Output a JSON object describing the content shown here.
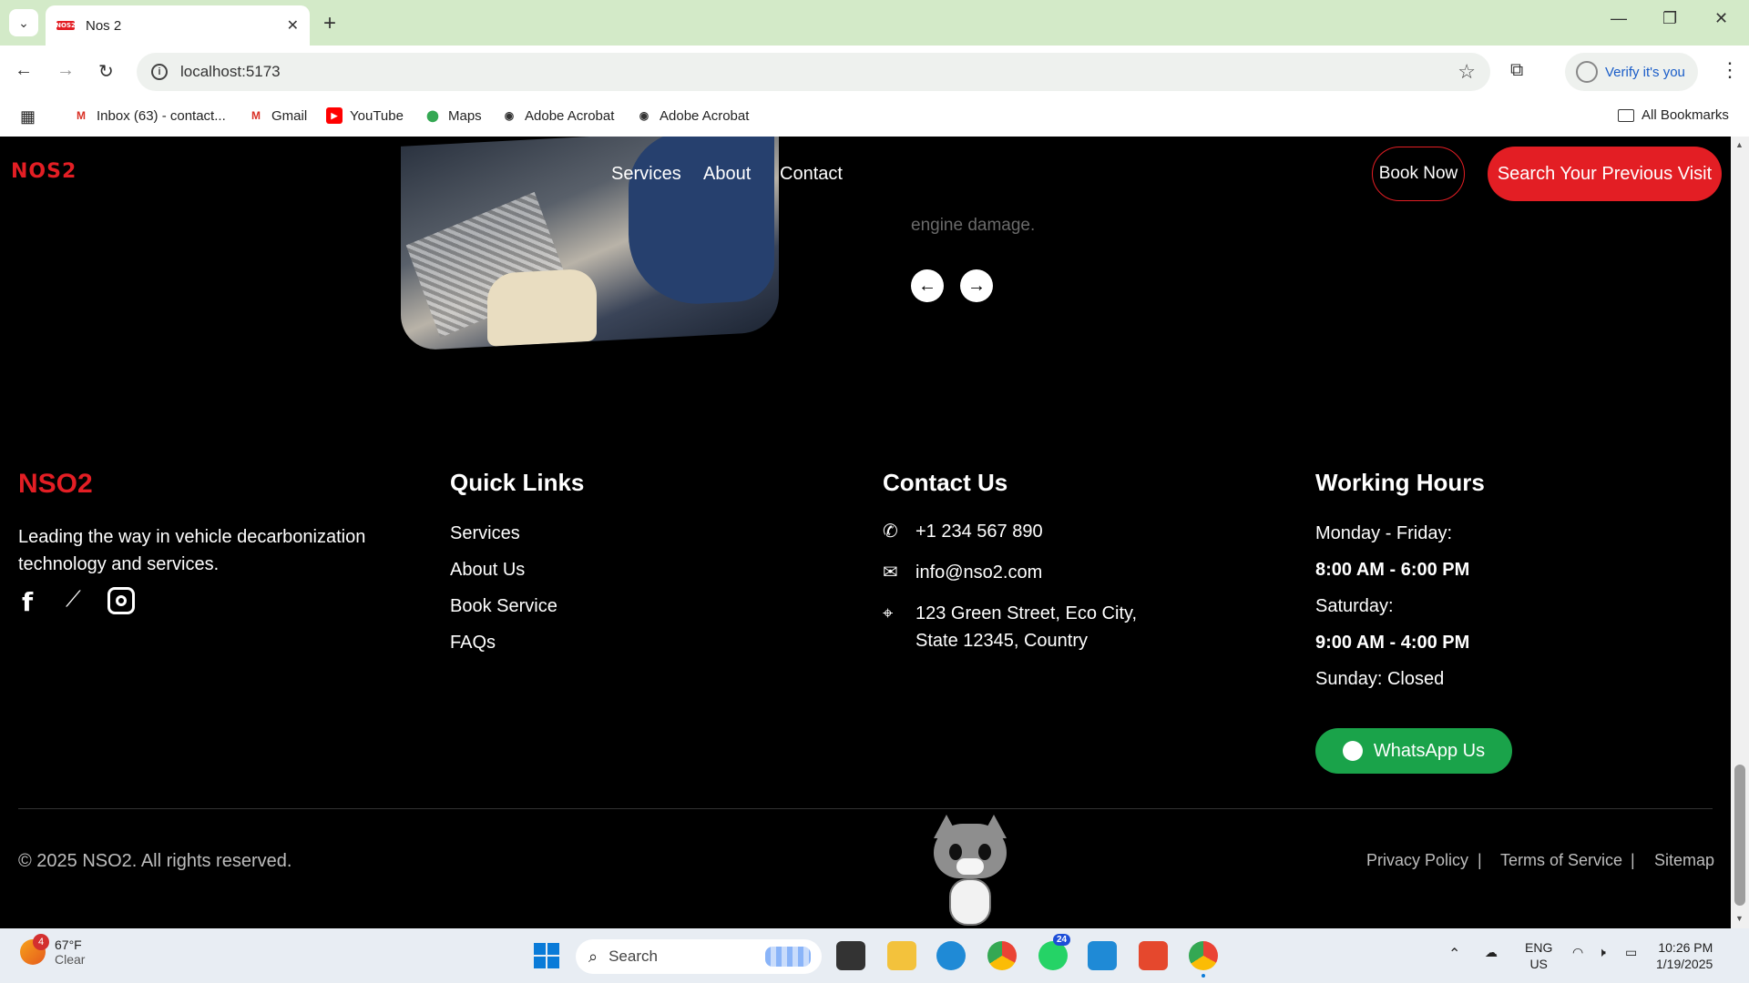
{
  "browser": {
    "tab_title": "Nos 2",
    "tab_favicon_text": "NOS2",
    "url": "localhost:5173",
    "verify_label": "Verify it's you",
    "bookmarks": [
      {
        "label": "Inbox (63) - contact...",
        "icon": "gmail-icon"
      },
      {
        "label": "Gmail",
        "icon": "gmail-icon"
      },
      {
        "label": "YouTube",
        "icon": "youtube-icon"
      },
      {
        "label": "Maps",
        "icon": "maps-icon"
      },
      {
        "label": "Adobe Acrobat",
        "icon": "globe-icon"
      },
      {
        "label": "Adobe Acrobat",
        "icon": "globe-icon"
      }
    ],
    "all_bookmarks_label": "All Bookmarks"
  },
  "carousel": {
    "description_fragment": "engine damage."
  },
  "nav": {
    "logo": "NOS2",
    "links": [
      "Services",
      "About",
      "Contact"
    ],
    "book_now": "Book Now",
    "search_visit": "Search Your Previous Visit"
  },
  "footer": {
    "brand": "NSO2",
    "tagline": "Leading the way in vehicle decarbonization technology and services.",
    "quick_links": {
      "heading": "Quick Links",
      "items": [
        "Services",
        "About Us",
        "Book Service",
        "FAQs"
      ]
    },
    "contact": {
      "heading": "Contact Us",
      "phone": "+1 234 567 890",
      "email": "info@nso2.com",
      "address_line1": "123 Green Street, Eco City,",
      "address_line2": "State 12345, Country"
    },
    "hours": {
      "heading": "Working Hours",
      "weekday_label": "Monday - Friday:",
      "weekday_hours": "8:00 AM - 6:00 PM",
      "saturday_label": "Saturday:",
      "saturday_hours": "9:00 AM - 4:00 PM",
      "sunday": "Sunday: Closed"
    },
    "whatsapp": "WhatsApp Us",
    "copyright": "© 2025 NSO2. All rights reserved.",
    "legal": [
      "Privacy Policy",
      "Terms of Service",
      "Sitemap"
    ],
    "separator": "|"
  },
  "taskbar": {
    "weather_temp": "67°F",
    "weather_desc": "Clear",
    "weather_badge": "4",
    "search_label": "Search",
    "whatsapp_badge": "24",
    "lang1": "ENG",
    "lang2": "US",
    "time": "10:26 PM",
    "date": "1/19/2025"
  },
  "colors": {
    "brand_red": "#e31e24",
    "whatsapp_green": "#1aa34a",
    "chrome_tabbar": "#d3eac8"
  }
}
